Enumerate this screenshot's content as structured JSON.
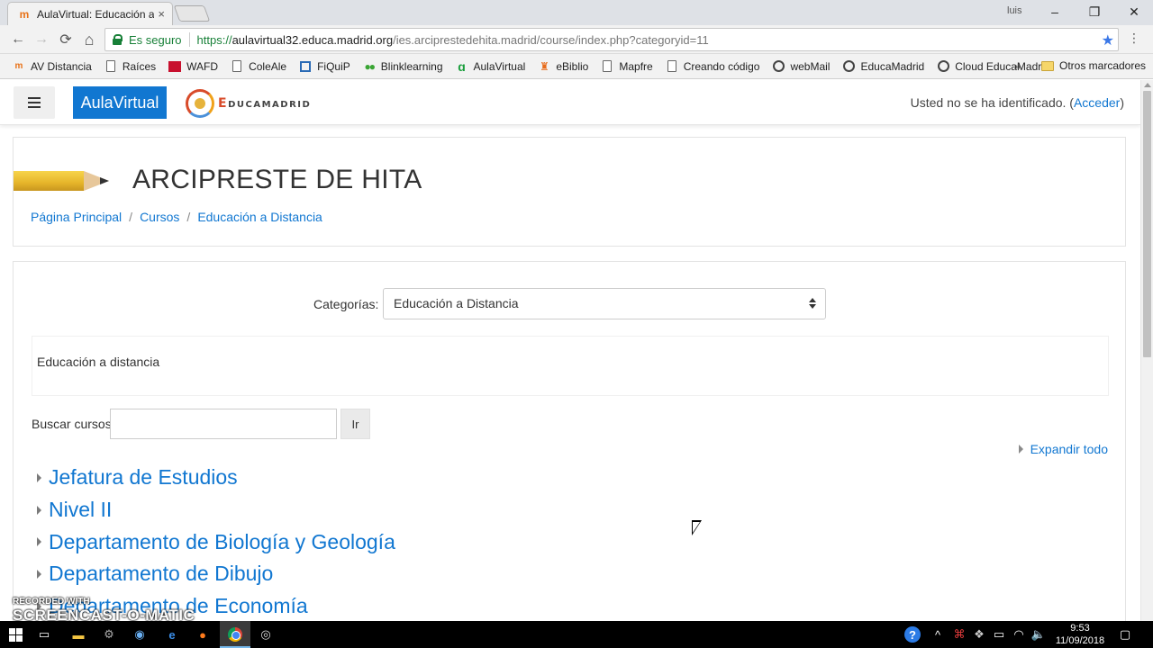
{
  "browser": {
    "tab_title": "AulaVirtual: Educación a",
    "tab_close": "×",
    "user_name": "luis",
    "minimize": "–",
    "maximize": "❐",
    "close": "✕",
    "back": "←",
    "forward": "→",
    "reload": "⟳",
    "home": "⌂",
    "secure_label": "Es seguro",
    "url_scheme": "https://",
    "url_host": "aulavirtual32.educa.madrid.org",
    "url_path": "/ies.arciprestedehita.madrid/course/index.php?categoryid=11",
    "star": "★",
    "menu": "⋮"
  },
  "bookmarks": {
    "items": [
      {
        "label": "AV Distancia",
        "icon": "moodle-icon"
      },
      {
        "label": "Raíces",
        "icon": "page-icon"
      },
      {
        "label": "WAFD",
        "icon": "wafd-icon"
      },
      {
        "label": "ColeAle",
        "icon": "page-icon"
      },
      {
        "label": "FiQuiP",
        "icon": "fiquip-icon"
      },
      {
        "label": "Blinklearning",
        "icon": "dots-icon"
      },
      {
        "label": "AulaVirtual",
        "icon": "aula-icon"
      },
      {
        "label": "eBiblio",
        "icon": "ebiblio-icon"
      },
      {
        "label": "Mapfre",
        "icon": "page-icon"
      },
      {
        "label": "Creando código",
        "icon": "page-icon"
      },
      {
        "label": "webMail",
        "icon": "globe-icon"
      },
      {
        "label": "EducaMadrid",
        "icon": "globe-icon"
      },
      {
        "label": "Cloud EducaMadrid",
        "icon": "globe-icon"
      }
    ],
    "more": "»",
    "other_label": "Otros marcadores"
  },
  "navbar": {
    "brand_label": "AulaVirtual",
    "educa_first": "E",
    "educa_rest": "DUCAMADRID",
    "login_text": "Usted no se ha identificado.",
    "login_link": "Acceder"
  },
  "header": {
    "site_title": "ARCIPRESTE DE HITA",
    "breadcrumb": [
      "Página Principal",
      "Cursos",
      "Educación a Distancia"
    ],
    "breadcrumb_sep": "/"
  },
  "main": {
    "categories_label": "Categorías:",
    "categories_selected": "Educación a Distancia",
    "description": "Educación a distancia",
    "search_label": "Buscar cursos",
    "search_value": "",
    "search_button": "Ir",
    "expand_all": "Expandir todo",
    "category_items": [
      "Jefatura de Estudios",
      "Nivel II",
      "Departamento de Biología y Geología",
      "Departamento de Dibujo",
      "Departamento de Economía"
    ]
  },
  "watermark": {
    "line1": "RECORDED WITH",
    "line2": "SCREENCAST-O-MATIC"
  },
  "taskbar": {
    "time": "9:53",
    "date": "11/09/2018"
  }
}
